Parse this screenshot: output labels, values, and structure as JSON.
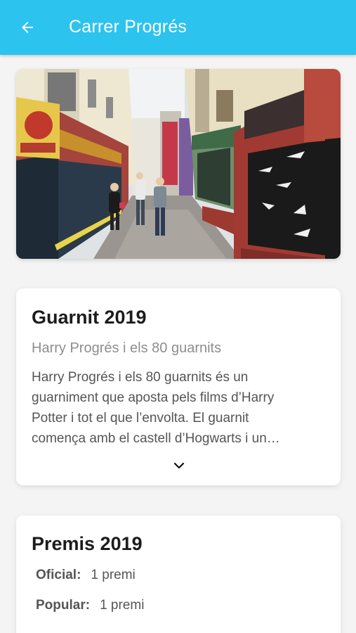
{
  "appbar": {
    "title": "Carrer Progrés",
    "back_icon": "arrow-left-icon",
    "background_color": "#2cc3ee"
  },
  "hero": {
    "image": "street-photo"
  },
  "guarnit": {
    "title": "Guarnit 2019",
    "subtitle": "Harry Progrés i els 80 guarnits",
    "description_lines": [
      "Harry Progrés i els 80 guarnits és un",
      "guarniment que aposta pels films d’Harry",
      "Potter i tot el que l’envolta. El guarnit",
      "comença amb el castell d’Hogwarts i un…"
    ],
    "expand_icon": "chevron-down-icon"
  },
  "premis": {
    "title": "Premis 2019",
    "oficial_label": "Oficial:",
    "oficial_value": "1 premi",
    "popular_label": "Popular:",
    "popular_value": "1 premi"
  }
}
